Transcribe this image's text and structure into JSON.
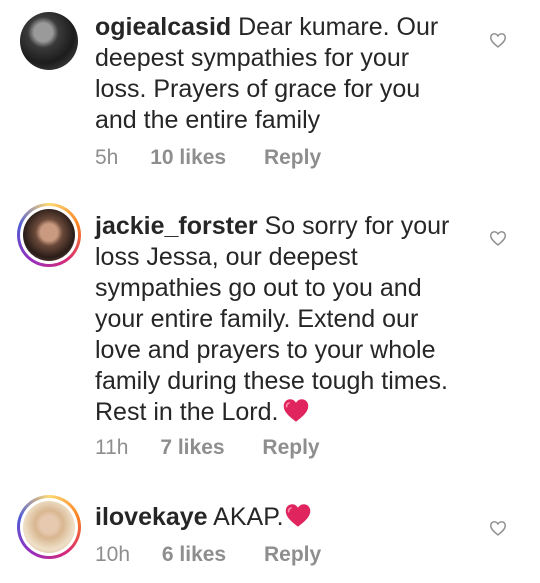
{
  "comments": [
    {
      "username": "ogiealcasid",
      "text": "Dear kumare. Our deepest sympathies for your loss. Prayers of grace for you and the entire family",
      "time": "5h",
      "likes": "10 likes",
      "reply": "Reply",
      "avatar_icon": "user-avatar",
      "has_story_ring": false,
      "emoji": ""
    },
    {
      "username": "jackie_forster",
      "text": "So sorry for your loss Jessa, our deepest sympathies go out to you and your entire family. Extend our love and prayers to your whole family during these tough times. Rest in the Lord.",
      "time": "11h",
      "likes": "7 likes",
      "reply": "Reply",
      "avatar_icon": "user-avatar",
      "has_story_ring": true,
      "emoji": "red-heart"
    },
    {
      "username": "ilovekaye",
      "text": "AKAP.",
      "time": "10h",
      "likes": "6 likes",
      "reply": "Reply",
      "avatar_icon": "user-avatar",
      "has_story_ring": true,
      "emoji": "red-heart"
    }
  ],
  "colors": {
    "text": "#262626",
    "meta": "#8e8e8e",
    "heart": "#e0245e"
  }
}
